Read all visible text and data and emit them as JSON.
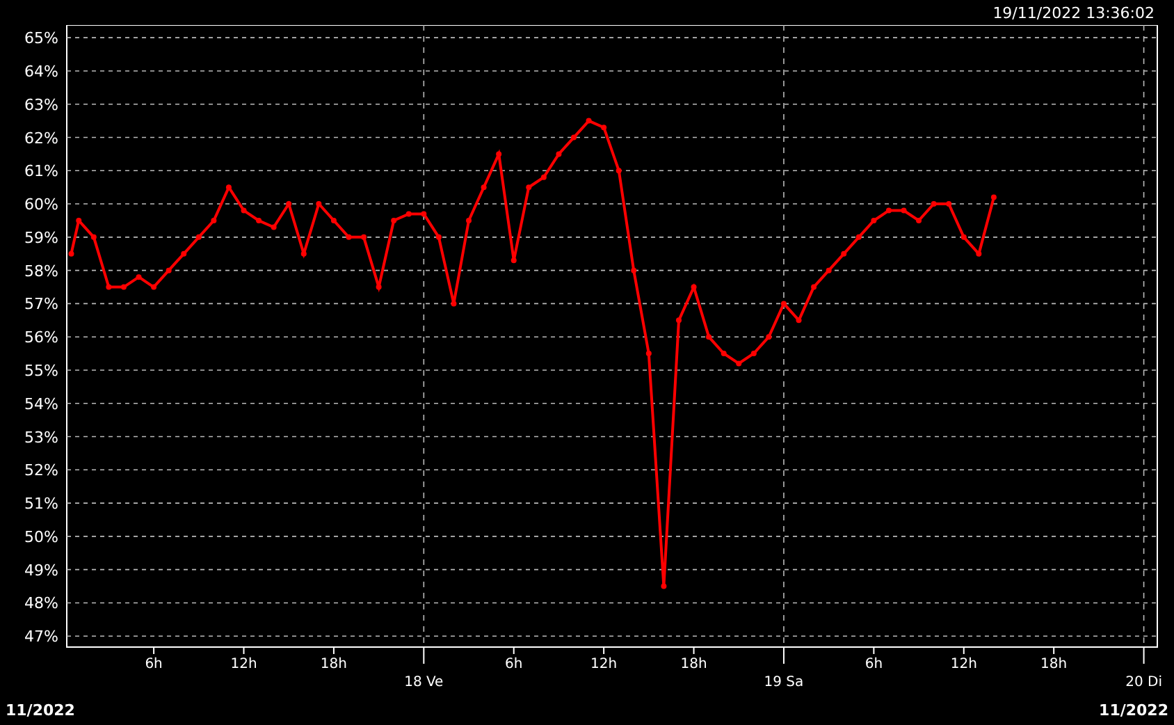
{
  "timestamp": "19/11/2022 13:36:02",
  "chart": {
    "chart_data": {
      "type": "line",
      "grid": true,
      "xlim": [
        0.2,
        72.9
      ],
      "ylim": [
        46.67,
        65.38
      ],
      "yticks": [
        {
          "value": 47,
          "label": "47%"
        },
        {
          "value": 48,
          "label": "48%"
        },
        {
          "value": 49,
          "label": "49%"
        },
        {
          "value": 50,
          "label": "50%"
        },
        {
          "value": 51,
          "label": "51%"
        },
        {
          "value": 52,
          "label": "52%"
        },
        {
          "value": 53,
          "label": "53%"
        },
        {
          "value": 54,
          "label": "54%"
        },
        {
          "value": 55,
          "label": "55%"
        },
        {
          "value": 56,
          "label": "56%"
        },
        {
          "value": 57,
          "label": "57%"
        },
        {
          "value": 58,
          "label": "58%"
        },
        {
          "value": 59,
          "label": "59%"
        },
        {
          "value": 60,
          "label": "60%"
        },
        {
          "value": 61,
          "label": "61%"
        },
        {
          "value": 62,
          "label": "62%"
        },
        {
          "value": 63,
          "label": "63%"
        },
        {
          "value": 64,
          "label": "64%"
        },
        {
          "value": 65,
          "label": "65%"
        }
      ],
      "xticks": [
        {
          "value": 6,
          "label": "6h"
        },
        {
          "value": 12,
          "label": "12h"
        },
        {
          "value": 18,
          "label": "18h"
        }
      ],
      "x": [
        0.5,
        1,
        2,
        3,
        4,
        5,
        6,
        7,
        8,
        9,
        10,
        11,
        12,
        13,
        14,
        15,
        16,
        17,
        18,
        19,
        20,
        21,
        22,
        23,
        24,
        25,
        26,
        27,
        28,
        29,
        30,
        31,
        32,
        33,
        34,
        35,
        36,
        37,
        38,
        39,
        40,
        41,
        42,
        43,
        44,
        45,
        46,
        47,
        48,
        49,
        50,
        51,
        52,
        53,
        54,
        55,
        56,
        57,
        58,
        59,
        60,
        61,
        62
      ],
      "series": [
        {
          "color": "#ff0000",
          "marker": "circle",
          "values": [
            58.5,
            59.5,
            59,
            57.5,
            57.5,
            57.8,
            57.5,
            58,
            58.5,
            59,
            59.5,
            60.5,
            59.8,
            59.5,
            59.3,
            60,
            58.5,
            60,
            59.5,
            59,
            59,
            57.5,
            59.5,
            59.7,
            59.7,
            59,
            57,
            59.5,
            60.5,
            61.5,
            58.3,
            60.5,
            60.8,
            61.5,
            62,
            62.5,
            62.3,
            61,
            58,
            55.5,
            48.5,
            56.5,
            57.5,
            56,
            55.5,
            55.2,
            55.5,
            56,
            57,
            56.5,
            57.5,
            58,
            58.5,
            59,
            59.5,
            59.8,
            59.8,
            59.5,
            60,
            60,
            59,
            58.5,
            60.2
          ]
        }
      ]
    },
    "x_axis": {
      "hour_labels": [
        "6h",
        "12h",
        "18h",
        "6h",
        "12h",
        "18h"
      ],
      "day_labels": [
        "18 Ve",
        "19 Sa",
        "20 Di"
      ]
    }
  },
  "footer": {
    "left": "11/2022",
    "right": "11/2022"
  }
}
